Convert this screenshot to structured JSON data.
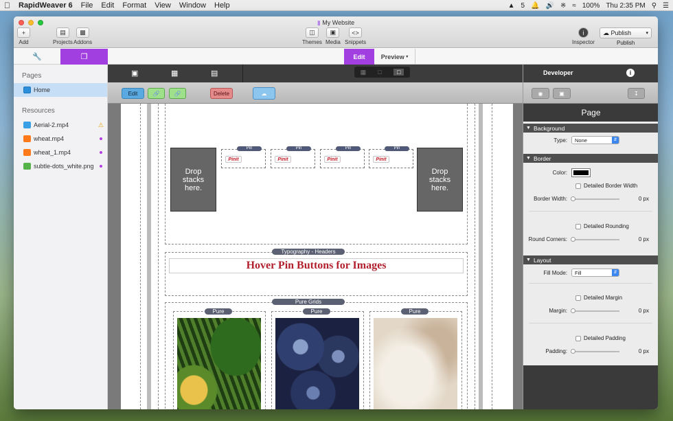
{
  "menubar": {
    "apple": "",
    "app": "RapidWeaver 6",
    "items": [
      "File",
      "Edit",
      "Format",
      "View",
      "Window",
      "Help"
    ],
    "badge": "5",
    "battery": "100%",
    "clock": "Thu 2:35 PM"
  },
  "window": {
    "title": "My Website"
  },
  "toolbar": {
    "add": "Add",
    "projects": "Projects",
    "addons": "Addons",
    "themes": "Themes",
    "media": "Media",
    "snippets": "Snippets",
    "inspector": "Inspector",
    "publish_btn": "Publish",
    "publish": "Publish"
  },
  "tabs": {
    "edit": "Edit",
    "preview": "Preview"
  },
  "sidebar": {
    "pages_header": "Pages",
    "pages": [
      {
        "label": "Home"
      }
    ],
    "resources_header": "Resources",
    "resources": [
      {
        "label": "Aerial-2.mp4",
        "color": "#3aa0e6",
        "flag": "warning"
      },
      {
        "label": "wheat.mp4",
        "color": "#ff7a1a",
        "flag": "dot"
      },
      {
        "label": "wheat_1.mp4",
        "color": "#ff7a1a",
        "flag": "dot"
      },
      {
        "label": "subtle-dots_white.png",
        "color": "#55b34a",
        "flag": "dot"
      }
    ]
  },
  "stacks_toolbar": {
    "edit": "Edit",
    "delete": "Delete"
  },
  "canvas": {
    "drop_left": "Drop stacks here.",
    "drop_right": "Drop stacks here.",
    "pin_labels": [
      "Pin",
      "Pin",
      "Pin",
      "Pin"
    ],
    "pin_button": "Pinit",
    "typography_label": "Typography - Headers",
    "heading": "Hover Pin Buttons for Images",
    "grids_label": "Pure Grids",
    "pure_labels": [
      "Pure",
      "Pure",
      "Pure"
    ]
  },
  "inspector": {
    "developer": "Developer",
    "title": "Page",
    "background": {
      "header": "Background",
      "type_label": "Type:",
      "type_value": "None"
    },
    "border": {
      "header": "Border",
      "color_label": "Color:",
      "detailed_width": "Detailed Border Width",
      "width_label": "Border Width:",
      "width_value": "0 px",
      "detailed_rounding": "Detailed Rounding",
      "corners_label": "Round Corners:",
      "corners_value": "0 px"
    },
    "layout": {
      "header": "Layout",
      "fill_label": "Fill Mode:",
      "fill_value": "Fill",
      "detailed_margin": "Detailed Margin",
      "margin_label": "Margin:",
      "margin_value": "0 px",
      "detailed_padding": "Detailed Padding",
      "padding_label": "Padding:",
      "padding_value": "0 px"
    }
  }
}
